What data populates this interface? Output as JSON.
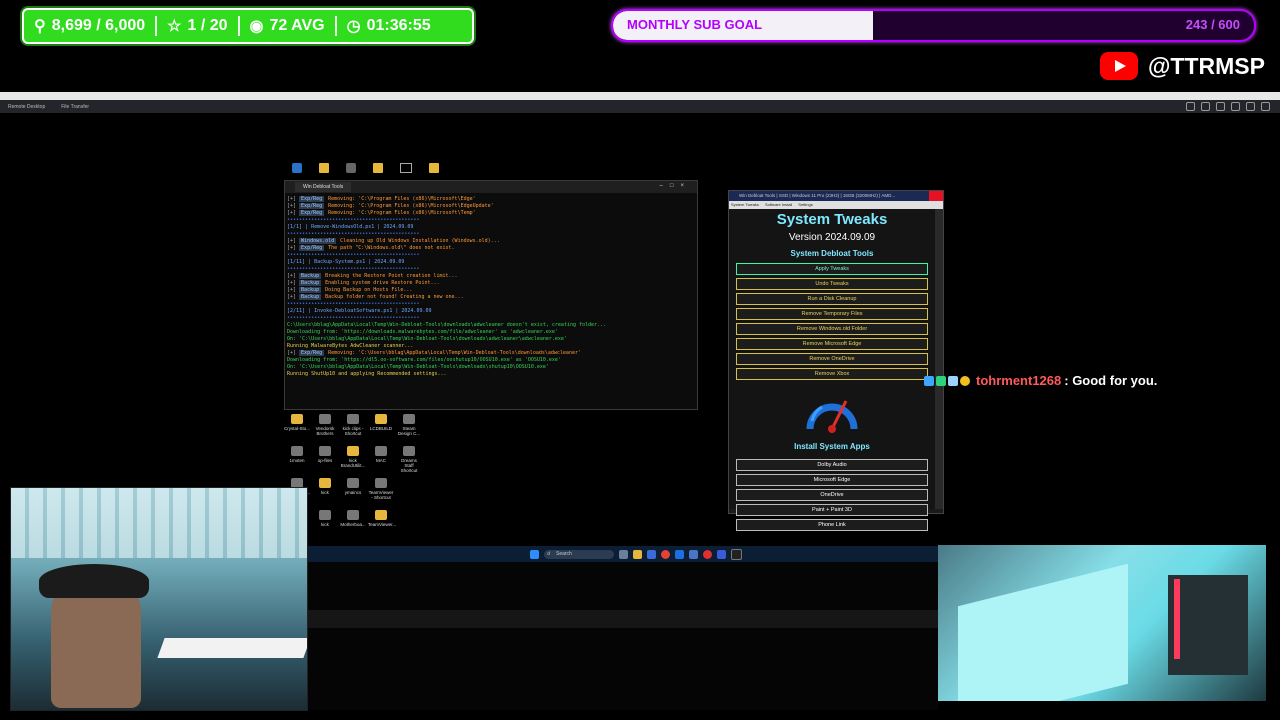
{
  "overlay": {
    "followers": "8,699 / 6,000",
    "rank": "1 / 20",
    "viewers": "72 AVG",
    "uptime": "01:36:55",
    "icons": {
      "followers": "person-icon",
      "rank": "star-icon",
      "viewers": "eye-icon",
      "uptime": "clock-icon"
    }
  },
  "sub_goal": {
    "title": "MONTHLY SUB GOAL",
    "count": "243 / 600",
    "progress": 0.405
  },
  "youtube": {
    "handle": "@TTRMSP"
  },
  "remote_desktop": {
    "tabs": [
      "Remote Desktop",
      "File Transfer"
    ]
  },
  "desktop_icons": [
    [
      "Crystal-Sto...",
      "Vendorsk Brothers",
      "kick clips - Shortcut",
      "LCDBUILD",
      "Steam Design C..."
    ],
    [
      "1moten",
      "op-files",
      "kick BrandUtilit...",
      "MAC",
      "Dreams Staff Shortcut"
    ],
    [
      "ZOTAC/GA...",
      "kick",
      "ymaincs",
      "TeamViewer - Shortcut"
    ],
    [
      "Brandol - Shortcut",
      "kick",
      "Motherboa...",
      "TeamViewer..."
    ]
  ],
  "terminal": {
    "tab_title": "Win Debloat Tools",
    "sections": [
      {
        "kind": "log",
        "lines": [
          {
            "tag": "Exp/Reg",
            "text": "Removing: 'C:\\Program Files (x86)\\Microsoft\\Edge'"
          },
          {
            "tag": "Exp/Reg",
            "text": "Removing: 'C:\\Program Files (x86)\\Microsoft\\EdgeUpdate'"
          },
          {
            "tag": "Exp/Reg",
            "text": "Removing: 'C:\\Program Files (x86)\\Microsoft\\Temp'"
          }
        ]
      },
      {
        "kind": "header",
        "text": "[1/1] | Remove-WindowsOld.ps1 | 2024.09.09"
      },
      {
        "kind": "log",
        "lines": [
          {
            "tag": "Windows.old",
            "text": "Cleaning up Old Windows Installation (Windows.old)..."
          },
          {
            "tag": "Exp/Reg",
            "text": "The path \"C:\\Windows.old\\\" does not exist."
          }
        ]
      },
      {
        "kind": "header",
        "text": "[1/11] | Backup-System.ps1 | 2024.09.09"
      },
      {
        "kind": "log",
        "lines": [
          {
            "tag": "Backup",
            "text": "Breaking the Restore Point creation limit..."
          },
          {
            "tag": "Backup",
            "text": "Enabling system drive Restore Point..."
          },
          {
            "tag": "Backup",
            "text": "Doing Backup on Hosts File..."
          },
          {
            "tag": "Backup",
            "text": "Backup folder not found! Creating a new one..."
          }
        ]
      },
      {
        "kind": "header",
        "text": "[2/11] | Invoke-DebloatSoftware.ps1 | 2024.09.09"
      },
      {
        "kind": "plain",
        "lines": [
          "C:\\Users\\bblag\\AppData\\Local\\Temp\\Win-Debloat-Tools\\downloads\\adwcleaner doesn't exist, creating folder...",
          "Downloading from: 'https://downloads.malwarebytes.com/file/adwcleaner' as 'adwcleaner.exe'",
          "On: 'C:\\Users\\bblag\\AppData\\Local\\Temp\\Win-Debloat-Tools\\downloads\\adwcleaner\\adwcleaner.exe'",
          "Running MalwareBytes AdwCleaner scanner..."
        ]
      },
      {
        "kind": "log",
        "lines": [
          {
            "tag": "Exp/Reg",
            "text": "Removing: 'C:\\Users\\bblag\\AppData\\Local\\Temp\\Win-Debloat-Tools\\downloads\\adwcleaner'"
          }
        ]
      },
      {
        "kind": "plain",
        "lines": [
          "Downloading from: 'https://dl5.oo-software.com/files/ooshutup10/OOSU10.exe' as 'OOSU10.exe'",
          "On: 'C:\\Users\\bblag\\AppData\\Local\\Temp\\Win-Debloat-Tools\\downloads\\shutup10\\OOSU10.exe'",
          "Running ShutUp10 and applying Recommended settings..."
        ]
      }
    ]
  },
  "tweaks": {
    "window_title": "Win Debloat Tools | SSD | Windows 11 Pro (23H2) | 16GB (3200MHz) | AMD...",
    "subtabs": [
      "System Tweaks",
      "Software Install",
      "Settings"
    ],
    "heading": "System Tweaks",
    "version": "Version 2024.09.09",
    "section1": "System Debloat Tools",
    "buttons": [
      "Apply Tweaks",
      "Undo Tweaks",
      "Run a Disk Cleanup",
      "Remove Temporary Files",
      "Remove Windows.old Folder",
      "Remove Microsoft Edge",
      "Remove OneDrive",
      "Remove Xbox"
    ],
    "section2": "Install System Apps",
    "apps": [
      "Dolby Audio",
      "Microsoft Edge",
      "OneDrive",
      "Paint + Paint 3D",
      "Phone Link"
    ]
  },
  "chat": {
    "username": "tohrment1268",
    "message": ": Good for you."
  },
  "taskbar": {
    "search_placeholder": "Search"
  },
  "colors": {
    "stats_green": "#31dc1f",
    "goal_purple": "#b300ff",
    "youtube_red": "#ff0000",
    "tweaks_accent": "#7fe8ff"
  }
}
